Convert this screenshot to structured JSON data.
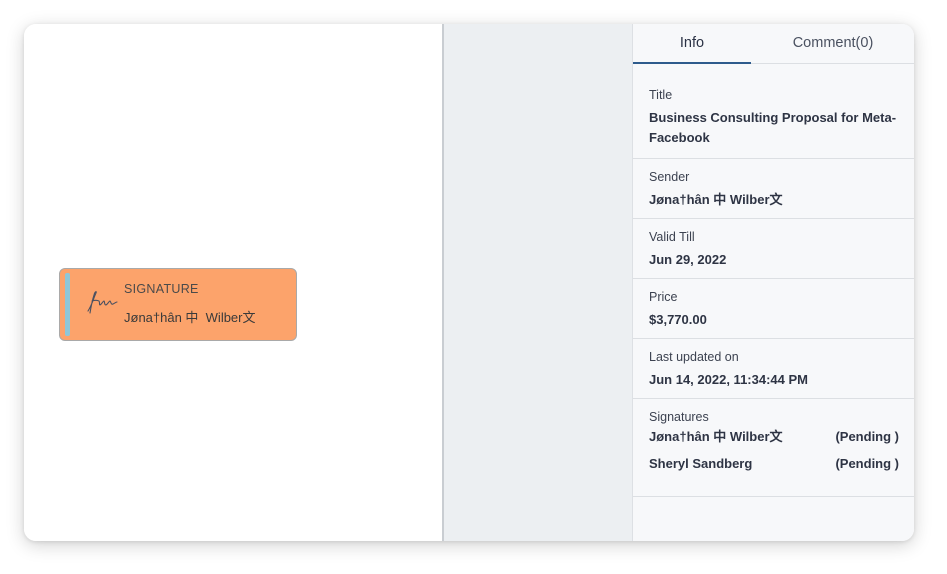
{
  "document": {
    "signature_field": {
      "label": "SIGNATURE",
      "signer_name": "Jøna†hân 中  Wilber文",
      "field_color": "#fca36b",
      "accent_color": "#8ec6d8"
    }
  },
  "panel": {
    "tabs": [
      {
        "label": "Info",
        "active": true
      },
      {
        "label": "Comment(0)",
        "active": false
      }
    ],
    "title": {
      "label": "Title",
      "value": "Business Consulting Proposal for Meta-Facebook"
    },
    "sender": {
      "label": "Sender",
      "value": "Jøna†hân 中 Wilber文"
    },
    "valid_till": {
      "label": "Valid Till",
      "value": "Jun 29, 2022"
    },
    "price": {
      "label": "Price",
      "value": "$3,770.00"
    },
    "last_updated": {
      "label": "Last updated on",
      "value": "Jun 14, 2022, 11:34:44 PM"
    },
    "signatures": {
      "label": "Signatures",
      "items": [
        {
          "name": "Jøna†hân 中 Wilber文",
          "status": "(Pending )"
        },
        {
          "name": "Sheryl Sandberg",
          "status": "(Pending )"
        }
      ]
    },
    "accent_color": "#2e5b8c"
  }
}
